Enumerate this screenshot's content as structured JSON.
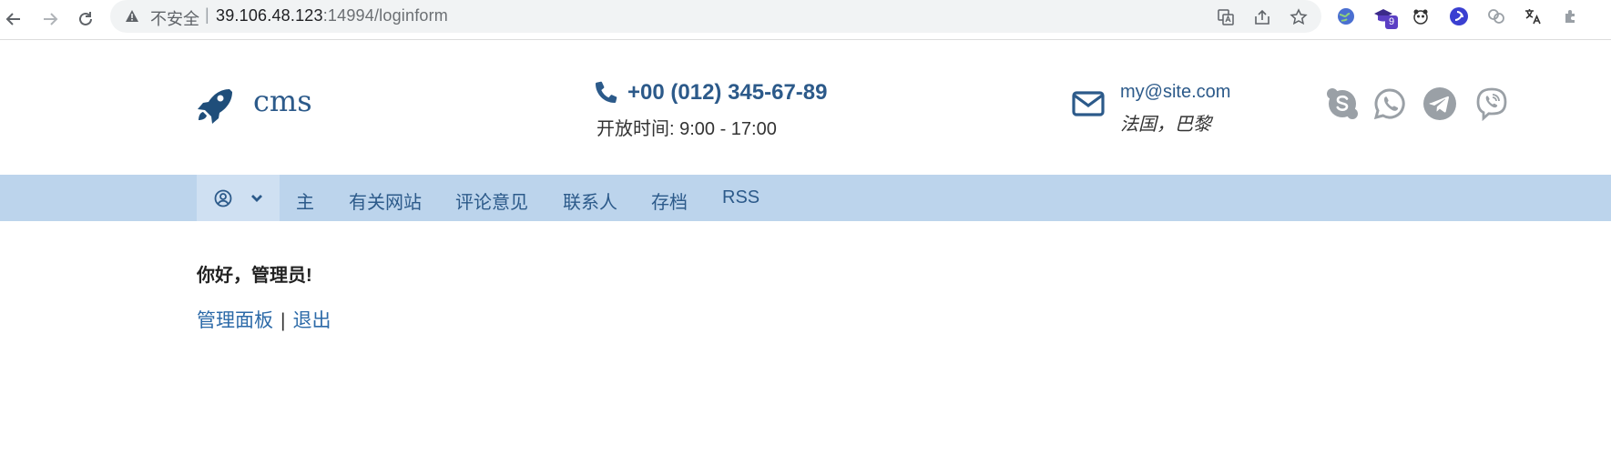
{
  "browser": {
    "security_label": "不安全",
    "separator": "|",
    "url_host": "39.106.48.123",
    "url_path": ":14994/loginform",
    "extension_badge": "9"
  },
  "header": {
    "brand": "cms",
    "phone": "+00 (012) 345-67-89",
    "hours": "开放时间: 9:00 - 17:00",
    "email": "my@site.com",
    "location": "法国，巴黎"
  },
  "social": [
    "skype-icon",
    "whatsapp-icon",
    "telegram-icon",
    "viber-icon"
  ],
  "nav": {
    "items": [
      "主",
      "有关网站",
      "评论意见",
      "联系人",
      "存档",
      "RSS"
    ]
  },
  "content": {
    "greeting": "你好，管理员!",
    "admin_link": "管理面板",
    "divider": "|",
    "logout_link": "退出"
  },
  "colors": {
    "brand": "#2c5a8a",
    "navbar": "#bcd4ec",
    "navbar_active": "#cfe0f2",
    "social_grey": "#9aa0a6"
  }
}
